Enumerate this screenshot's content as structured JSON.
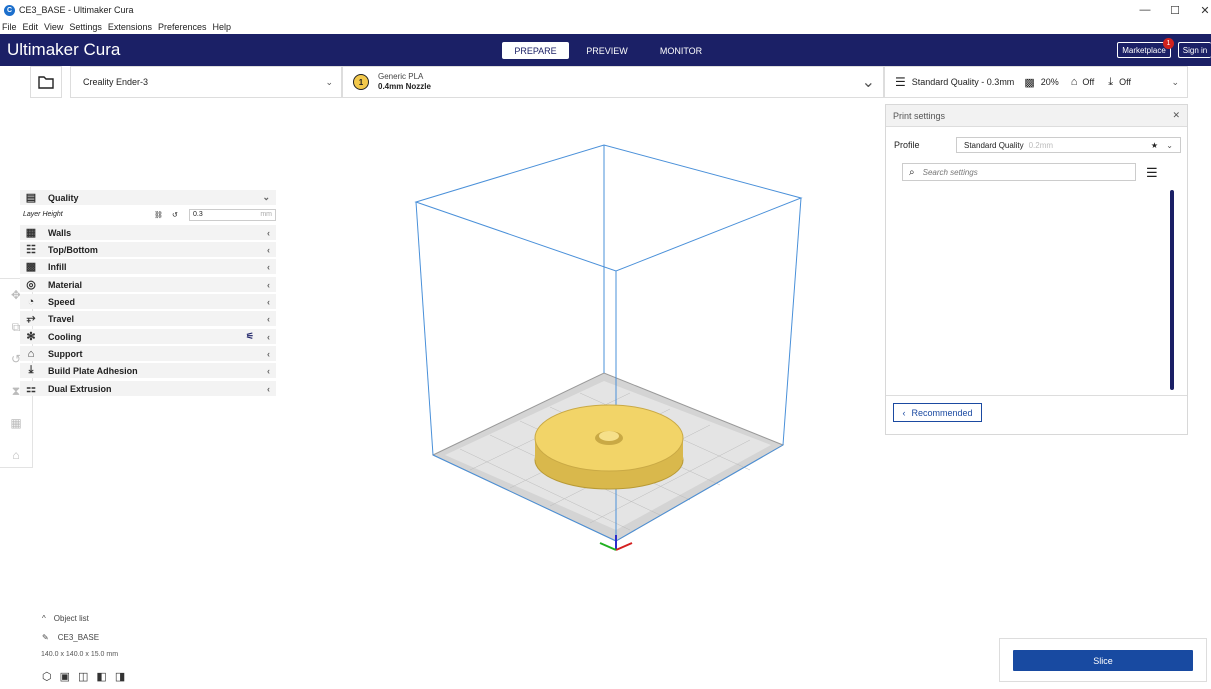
{
  "window": {
    "title": "CE3_BASE - Ultimaker Cura",
    "app_icon": "C",
    "minimize": "—",
    "maximize": "☐",
    "close": "✕"
  },
  "menu": [
    "File",
    "Edit",
    "View",
    "Settings",
    "Extensions",
    "Preferences",
    "Help"
  ],
  "header": {
    "brand_bold": "Ultimaker",
    "brand_light": " Cura",
    "stages": [
      "PREPARE",
      "PREVIEW",
      "MONITOR"
    ],
    "marketplace": "Marketplace",
    "marketplace_badge": "1",
    "signin": "Sign in"
  },
  "toolbar": {
    "printer": "Creality Ender-3",
    "extruder_num": "1",
    "material": "Generic PLA",
    "nozzle": "0.4mm Nozzle",
    "quality": "Standard Quality - 0.3mm",
    "infill": "20%",
    "support": "Off",
    "adhesion": "Off"
  },
  "print_settings": {
    "title": "Print settings",
    "profile_label": "Profile",
    "profile_value": "Standard Quality",
    "profile_dim": "0.2mm",
    "search_placeholder": "Search settings",
    "quality_cat": "Quality",
    "layer_height_label": "Layer Height",
    "layer_height_value": "0.3",
    "layer_height_unit": "mm",
    "categories": [
      "Walls",
      "Top/Bottom",
      "Infill",
      "Material",
      "Speed",
      "Travel",
      "Cooling",
      "Support",
      "Build Plate Adhesion",
      "Dual Extrusion"
    ],
    "recommended": "Recommended"
  },
  "object": {
    "list_label": "Object list",
    "name": "CE3_BASE",
    "dims": "140.0 x 140.0 x 15.0 mm"
  },
  "slice": "Slice"
}
